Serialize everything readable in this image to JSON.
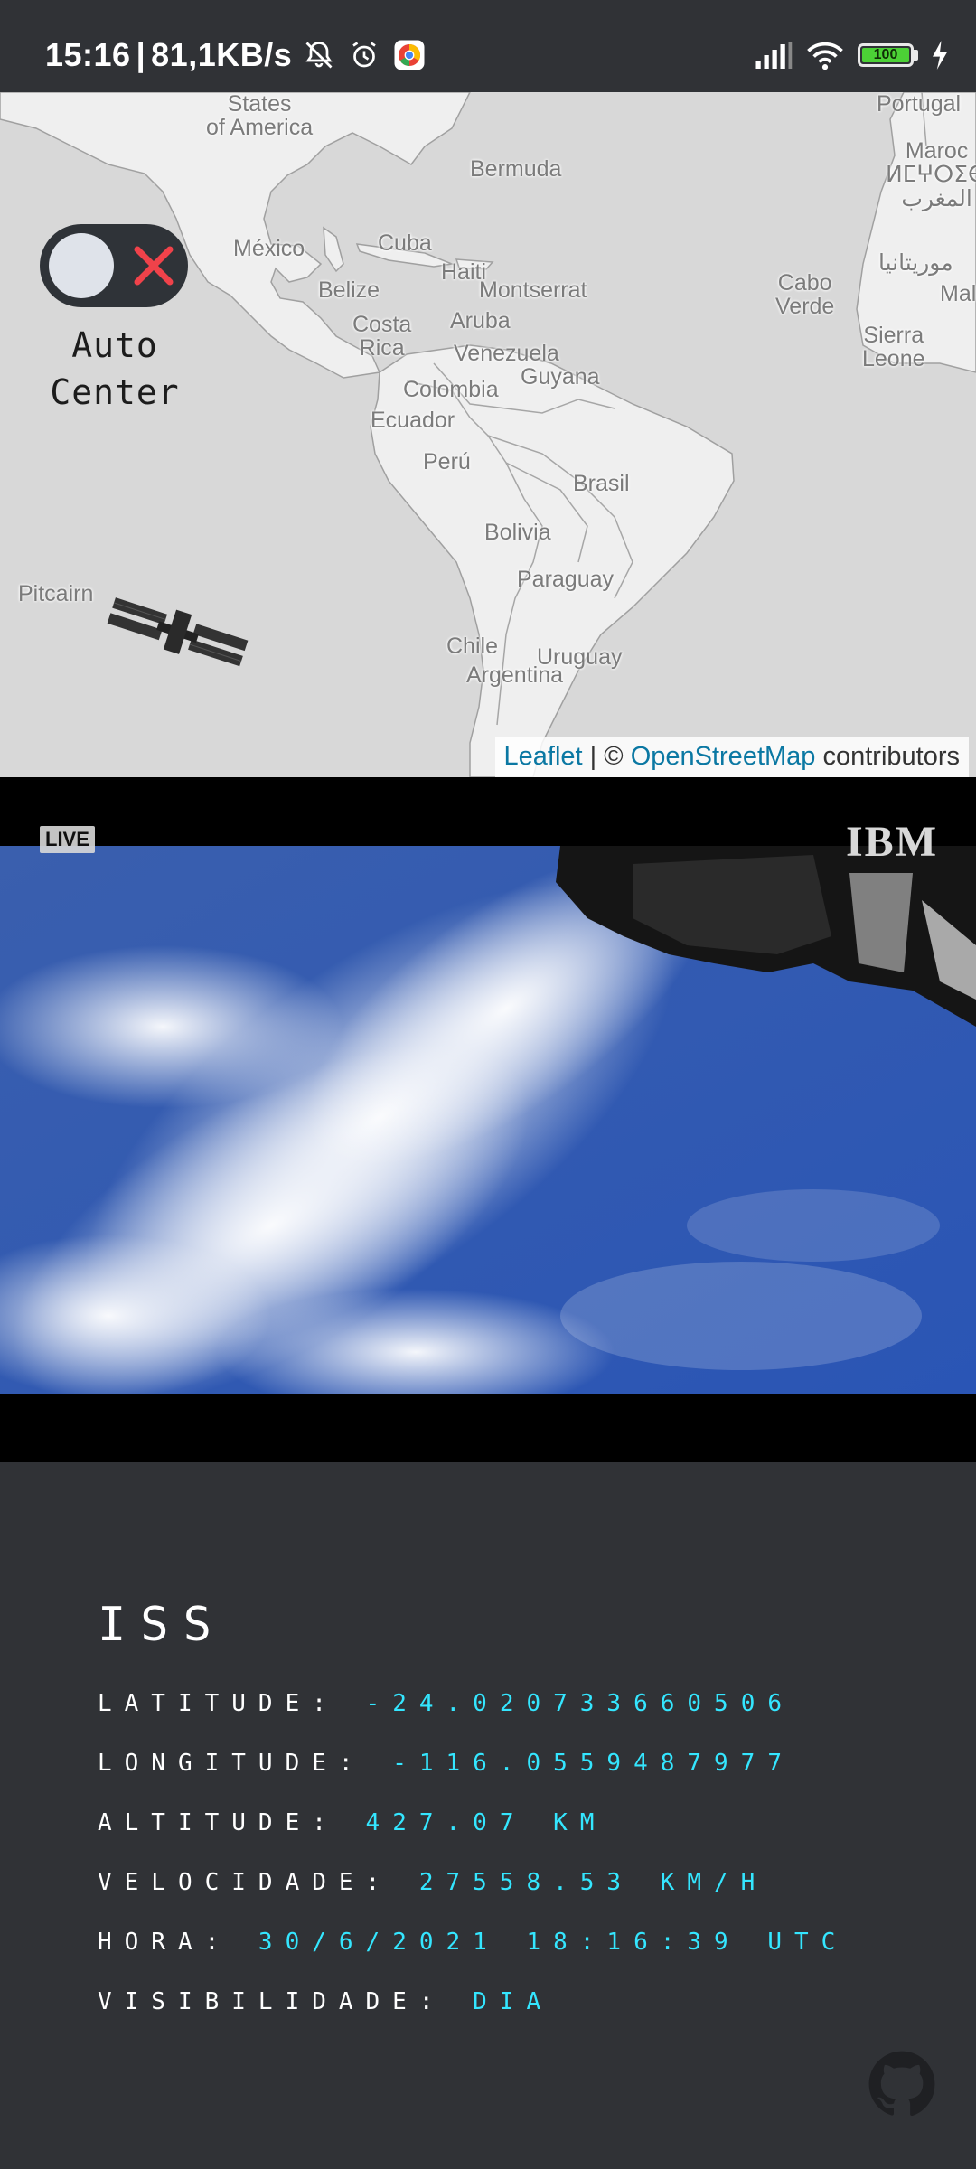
{
  "status_bar": {
    "time": "15:16",
    "network_speed": "81,1KB/s",
    "battery_level": "100",
    "icons": [
      "notifications-off-icon",
      "alarm-icon",
      "chrome-icon",
      "signal-icon",
      "wifi-icon",
      "battery-icon",
      "charging-icon"
    ]
  },
  "map": {
    "labels": {
      "usa": "States\nof America",
      "portugal": "Portugal",
      "bermuda": "Bermuda",
      "maroc": "Maroc\nⵍⵎⵖⵔⵉⴱ\nالمغرب",
      "mexico": "México",
      "cuba": "Cuba",
      "haiti": "Haiti",
      "belize": "Belize",
      "montserrat": "Montserrat",
      "costa_rica": "Costa\nRica",
      "aruba": "Aruba",
      "venezuela": "Venezuela",
      "guyana": "Guyana",
      "colombia": "Colombia",
      "ecuador": "Ecuador",
      "peru": "Perú",
      "brasil": "Brasil",
      "bolivia": "Bolivia",
      "paraguay": "Paraguay",
      "chile": "Chile",
      "argentina": "Argentina",
      "uruguay": "Uruguay",
      "pitcairn": "Pitcairn",
      "cabo_verde": "Cabo\nVerde",
      "mauritania": "موريتانيا",
      "mali": "Mal",
      "sierra_leone": "Sierra\nLeone"
    },
    "attribution": {
      "leaflet": "Leaflet",
      "separator": " | © ",
      "osm": "OpenStreetMap",
      "suffix": " contributors"
    },
    "auto_center": {
      "label": "Auto\nCenter",
      "enabled": false
    }
  },
  "video": {
    "live_label": "LIVE",
    "brand": "IBM"
  },
  "iss": {
    "title": "ISS",
    "latitude_label": "LATITUDE: ",
    "latitude": "-24.020733660506",
    "longitude_label": "LONGITUDE: ",
    "longitude": "-116.0559487977",
    "altitude_label": "ALTITUDE: ",
    "altitude": "427.07 KM",
    "velocity_label": "VELOCIDADE: ",
    "velocity": "27558.53 KM/H",
    "time_label": "HORA: ",
    "time": "30/6/2021 18:16:39 UTC",
    "visibility_label": "VISIBILIDADE: ",
    "visibility": "DIA"
  },
  "colors": {
    "background": "#303236",
    "value_cyan": "#34e6ff",
    "toggle_x": "#f0424a",
    "link": "#0b78a3"
  }
}
